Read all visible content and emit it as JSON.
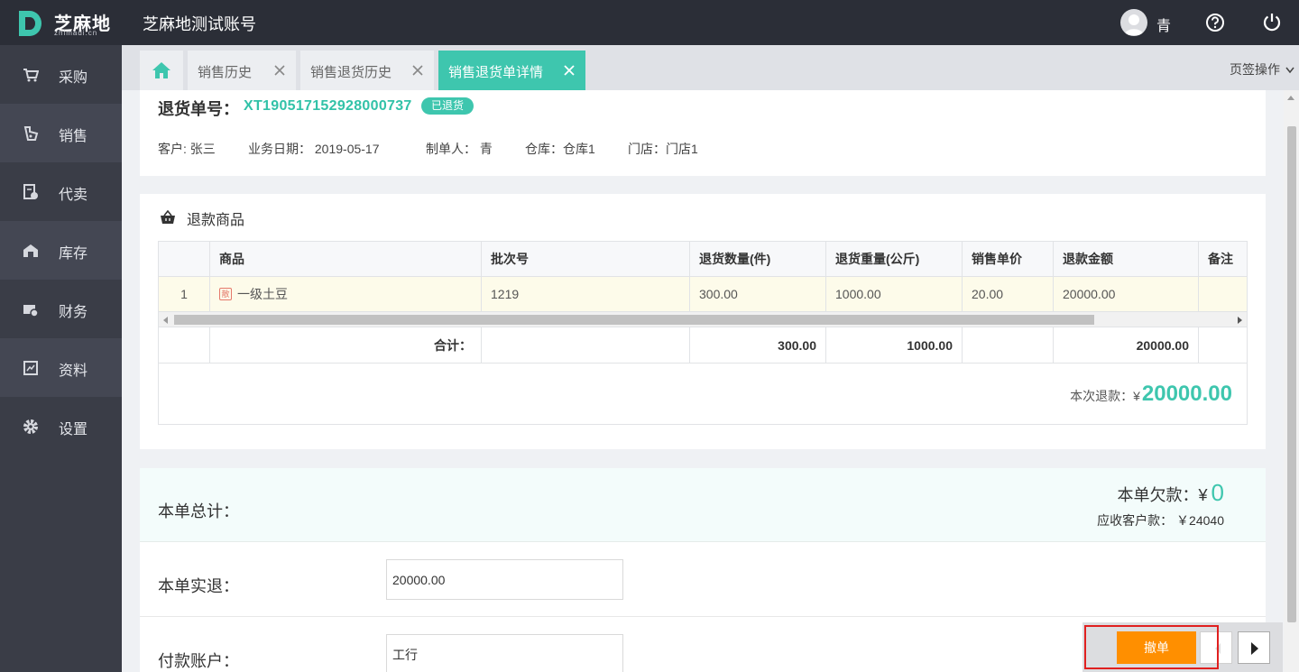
{
  "app": {
    "logo_name": "芝麻地",
    "logo_sub": "zhimadi.cn",
    "account_name": "芝麻地测试账号"
  },
  "header": {
    "user_name": "青",
    "icons": [
      "user-avatar",
      "help-icon",
      "power-icon"
    ]
  },
  "sidebar": {
    "items": [
      {
        "label": "采购",
        "icon": "cart-icon"
      },
      {
        "label": "销售",
        "icon": "sale-icon"
      },
      {
        "label": "代卖",
        "icon": "consign-icon"
      },
      {
        "label": "库存",
        "icon": "warehouse-icon"
      },
      {
        "label": "财务",
        "icon": "finance-icon"
      },
      {
        "label": "资料",
        "icon": "data-icon"
      },
      {
        "label": "设置",
        "icon": "gear-icon"
      }
    ]
  },
  "tabs": {
    "items": [
      {
        "label": "销售历史",
        "active": false
      },
      {
        "label": "销售退货历史",
        "active": false
      },
      {
        "label": "销售退货单详情",
        "active": true
      }
    ],
    "ops_label": "页签操作"
  },
  "order": {
    "label": "退货单号：",
    "number": "XT190517152928000737",
    "status": "已退货",
    "customer": "客户: 张三",
    "date": "业务日期： 2019-05-17",
    "creator": "制单人： 青",
    "warehouse": "仓库：仓库1",
    "store": "门店：门店1"
  },
  "products": {
    "title": "退款商品",
    "columns": [
      "商品",
      "批次号",
      "退货数量(件)",
      "退货重量(公斤)",
      "销售单价",
      "退款金额",
      "备注"
    ],
    "rows": [
      {
        "index": "1",
        "tag": "散",
        "name": "一级土豆",
        "batch": "1219",
        "qty": "300.00",
        "weight": "1000.00",
        "price": "20.00",
        "amount": "20000.00",
        "note": ""
      }
    ],
    "footer": {
      "label": "合计：",
      "qty": "300.00",
      "weight": "1000.00",
      "amount": "20000.00"
    },
    "refund_label": "本次退款：",
    "currency": "¥",
    "refund_value": "20000.00"
  },
  "totals": {
    "title": "本单总计：",
    "debt_label": "本单欠款：¥",
    "debt_value": "0",
    "receivable": "应收客户款： ￥24040",
    "actual_label": "本单实退：",
    "actual_value": "20000.00",
    "account_label": "付款账户：",
    "account_value": "工行"
  },
  "actions": {
    "undo_label": "撤单"
  },
  "colors": {
    "accent": "#3ec6ae",
    "topbar": "#2b2e37",
    "sidebar": "#3a3d47",
    "undo": "#ff8f00"
  }
}
